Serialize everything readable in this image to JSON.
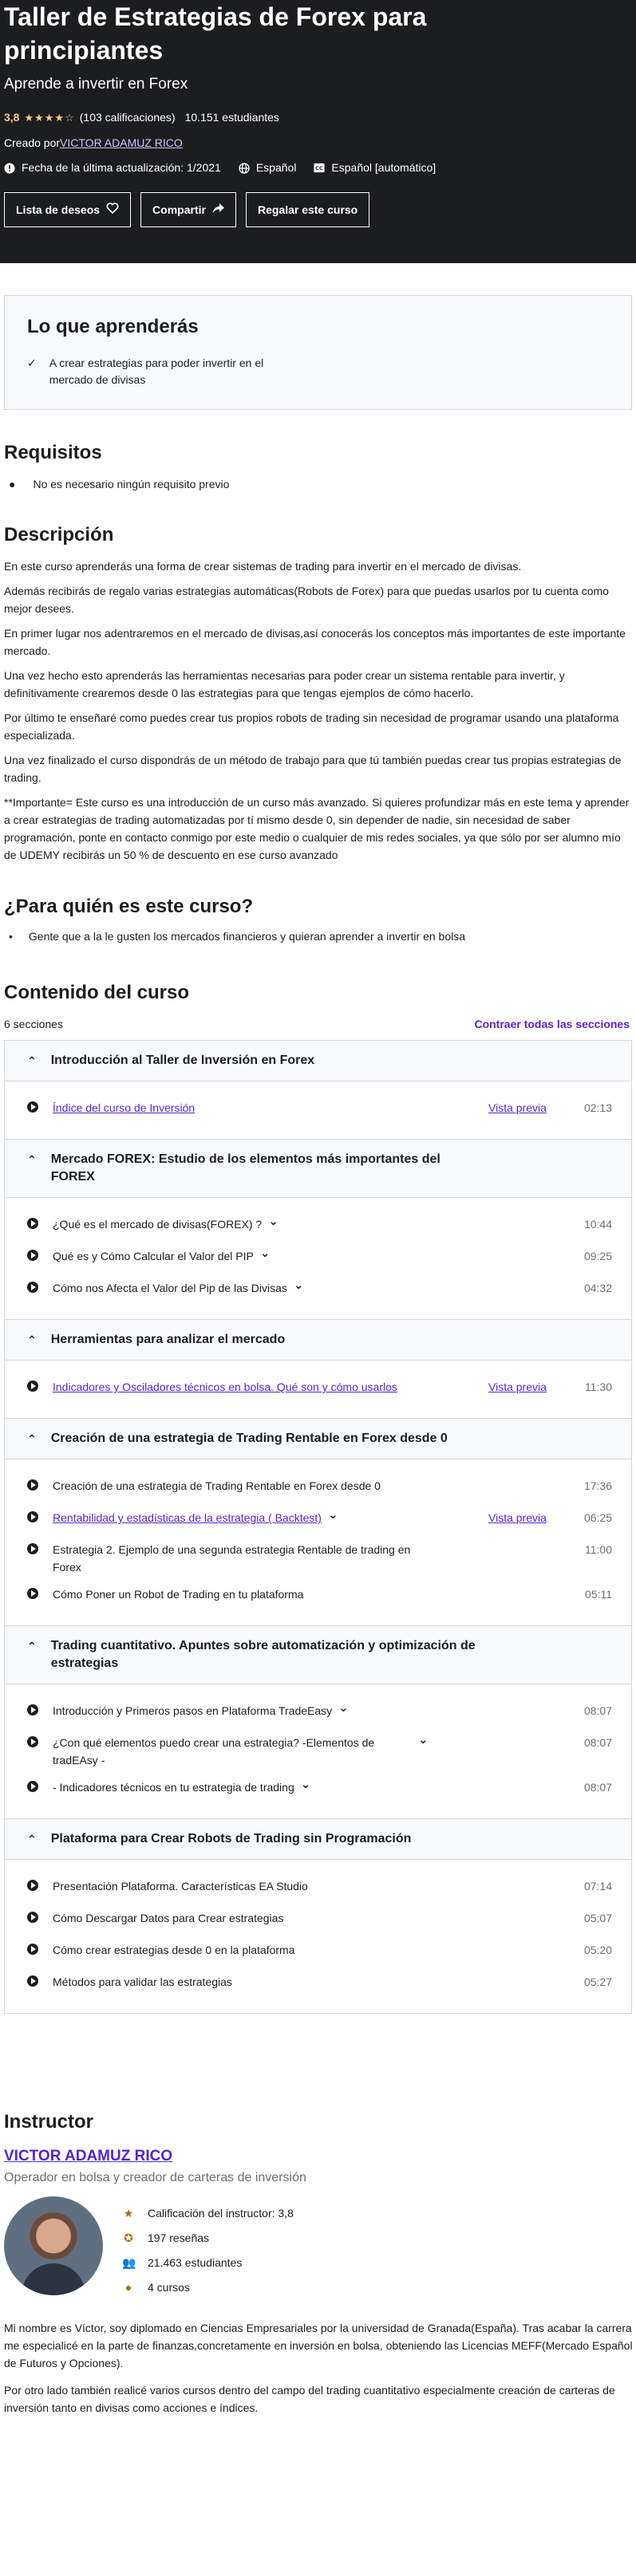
{
  "header": {
    "title": "Taller de Estrategias de Forex para principiantes",
    "subtitle": "Aprende a invertir en Forex",
    "rating": "3,8",
    "stars": "★★★★☆",
    "rating_count": "(103 calificaciones)",
    "students": "10.151 estudiantes",
    "created_by_prefix": "Creado por",
    "creator": "VICTOR ADAMUZ RICO",
    "last_update": "Fecha de la última actualización: 1/2021",
    "language": "Español",
    "captions": "Español [automático]",
    "buttons": {
      "wishlist": "Lista de deseos",
      "share": "Compartir",
      "gift": "Regalar este curso"
    }
  },
  "learn": {
    "title": "Lo que aprenderás",
    "items": [
      "A crear estrategias para poder invertir en el mercado de divisas"
    ]
  },
  "requirements": {
    "title": "Requisitos",
    "items": [
      "No es necesario ningún requisito previo"
    ]
  },
  "description": {
    "title": "Descripción",
    "paragraphs": [
      "En este curso aprenderás una forma de crear sistemas de trading para invertir en el mercado de divisas.",
      "Además recibirás de regalo varias estrategias automáticas(Robots de Forex) para que puedas usarlos por tu cuenta como mejor desees.",
      "En primer lugar nos adentraremos en el mercado de divisas,así conocerás los conceptos más importantes de este importante mercado.",
      "Una vez hecho esto aprenderás las herramientas necesarias para poder crear un sistema rentable para invertir, y definitivamente crearemos desde 0 las estrategias para que tengas ejemplos de cómo hacerlo.",
      "Por último te enseñaré como puedes crear tus propios robots de trading sin necesidad de programar usando una plataforma especializada.",
      "Una vez finalizado el curso dispondrás de un método de trabajo para que tú también puedas crear tus propias estrategias de trading.",
      "**Importante= Este curso es una introducción de un curso más avanzado. Si quieres profundizar más en este tema y aprender a crear estrategias de trading automatizadas por tí mismo desde 0, sin depender de nadie, sin necesidad de saber programación, ponte en contacto conmigo por este medio o cualquier de mis redes sociales, ya que sólo por ser alumno mío de UDEMY recibirás un 50 % de descuento en ese curso avanzado"
    ]
  },
  "for_who": {
    "title": "¿Para quién es este curso?",
    "items": [
      "Gente que a la le gusten los mercados financieros y quieran aprender a invertir en bolsa"
    ]
  },
  "content": {
    "title": "Contenido del curso",
    "sections_count": "6 secciones",
    "collapse_all": "Contraer todas las secciones",
    "chapters": [
      {
        "title": "Introducción al Taller de Inversión en Forex",
        "lectures": [
          {
            "name": "Índice del curso de Inversión",
            "preview": "Vista previa",
            "duration": "02:13"
          }
        ]
      },
      {
        "title": "Mercado FOREX: Estudio de los elementos más importantes del FOREX",
        "lectures": [
          {
            "name": "¿Qué es el mercado de divisas(FOREX) ?",
            "duration": "10:44"
          },
          {
            "name": "Qué es y Cómo Calcular el Valor del PIP",
            "duration": "09:25"
          },
          {
            "name": "Cómo nos Afecta el Valor del Pip de las Divisas",
            "duration": "04:32"
          }
        ]
      },
      {
        "title": "Herramientas para analizar el mercado",
        "lectures": [
          {
            "name": "Indicadores y Osciladores técnicos en bolsa. Qué son y cómo usarlos",
            "preview": "Vista previa",
            "duration": "11:30"
          }
        ]
      },
      {
        "title": "Creación de una estrategia de Trading Rentable en Forex desde 0",
        "lectures": [
          {
            "name": "Creación de una estrategia de Trading Rentable en Forex desde 0",
            "duration": "17:36"
          },
          {
            "name": "Rentabilidad y estadísticas de la estrategia ( Backtest)",
            "preview": "Vista previa",
            "duration": "06:25"
          },
          {
            "name": "Estrategia 2. Ejemplo de una segunda estrategia Rentable de trading en Forex",
            "duration": "11:00"
          },
          {
            "name": "Cómo Poner un Robot de Trading en tu plataforma",
            "duration": "05:11"
          }
        ]
      },
      {
        "title": "Trading cuantitativo. Apuntes sobre automatización y optimización de estrategias",
        "lectures": [
          {
            "name": "Introducción y Primeros pasos en Plataforma TradeEasy",
            "duration": "08:07"
          },
          {
            "name": "¿Con qué elementos puedo crear una estrategia? -Elementos de tradEAsy -",
            "duration": "08:07"
          },
          {
            "name": "- Indicadores técnicos en tu estrategia de trading",
            "duration": "08:07"
          }
        ]
      },
      {
        "title": "Plataforma para Crear Robots de Trading sin Programación",
        "lectures": [
          {
            "name": "Presentación Plataforma. Características EA Studio",
            "duration": "07:14"
          },
          {
            "name": "Cómo Descargar Datos para Crear estrategias",
            "duration": "05:07"
          },
          {
            "name": "Cómo crear estrategias desde 0 en la plataforma",
            "duration": "05:20"
          },
          {
            "name": "Métodos para validar las estrategias",
            "duration": "05:27"
          }
        ]
      }
    ]
  },
  "instructor": {
    "title": "Instructor",
    "name": "VICTOR ADAMUZ RICO",
    "tagline": "Operador en bolsa y creador de carteras de inversión",
    "rating": "Calificación del instructor: 3,8",
    "reviews": "197 reseñas",
    "students": "21.463 estudiantes",
    "courses": "4 cursos",
    "bio": [
      "Mi nombre es Víctor, soy diplomado en Ciencias Empresariales por la universidad de Granada(España). Tras acabar la carrera me especialicé en la parte de finanzas,concretamente en inversión en bolsa, obteniendo las Licencias MEFF(Mercado Español de Futuros y Opciones).",
      "Por otro lado también realicé varios cursos dentro del campo del trading cuantitativo especialmente creación de carteras de inversión tanto en divisas como acciones e índices."
    ]
  }
}
